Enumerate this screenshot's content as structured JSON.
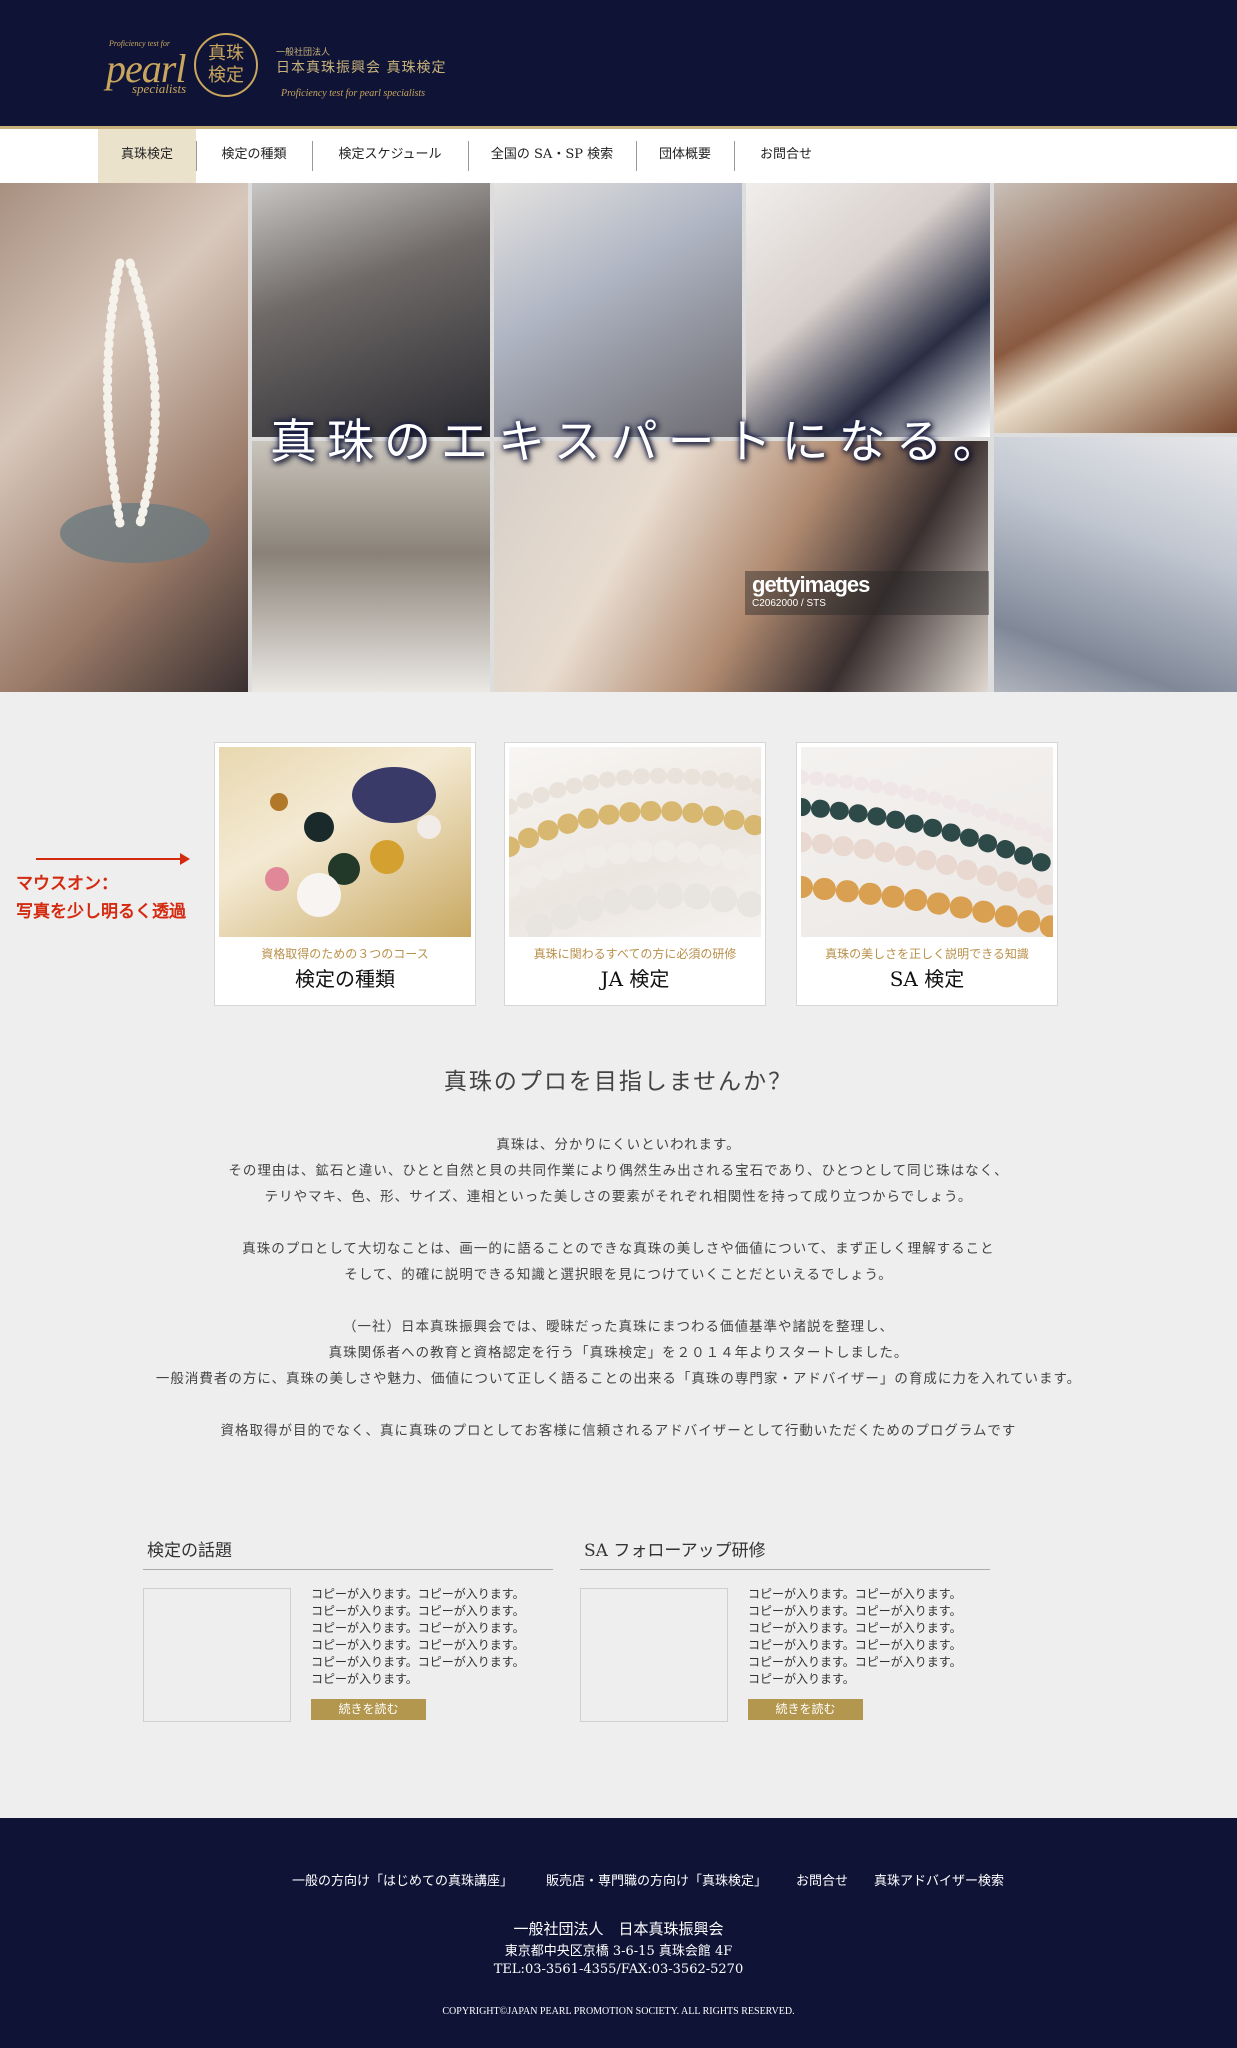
{
  "header": {
    "logo": {
      "small_text": "Proficiency test for",
      "wordmark": "pearl",
      "wordmark_sub": "specialists",
      "seal_line1": "真珠",
      "seal_line2": "検定",
      "org_small": "一般社団法人",
      "org_name": "日本真珠振興会 真珠検定",
      "subtitle": "Proficiency test for pearl specialists"
    },
    "bg_color": "#0f1437",
    "accent_color": "#c9b27a"
  },
  "nav": {
    "items": [
      {
        "label": "真珠検定",
        "active": true
      },
      {
        "label": "検定の種類",
        "active": false
      },
      {
        "label": "検定スケジュール",
        "active": false
      },
      {
        "label": "全国の SA・SP 検索",
        "active": false
      },
      {
        "label": "団体概要",
        "active": false
      },
      {
        "label": "お問合せ",
        "active": false
      }
    ]
  },
  "hero": {
    "title": "真珠のエキスパートになる。",
    "watermark": "gettyimages",
    "watermark_credit": "C2062000 / STS"
  },
  "cards": [
    {
      "subtitle": "資格取得のための３つのコース",
      "title": "検定の種類",
      "image": "colorful-pearls-photo"
    },
    {
      "subtitle": "真珠に関わるすべての方に必須の研修",
      "title": "JA 検定",
      "image": "white-gold-pearl-strands-photo"
    },
    {
      "subtitle": "真珠の美しさを正しく説明できる知識",
      "title": "SA 検定",
      "image": "multicolor-pearl-strands-photo"
    }
  ],
  "annotation": {
    "line1": "マウスオン：",
    "line2": "写真を少し明るく透過",
    "color": "#d42a10"
  },
  "intro": {
    "heading": "真珠のプロを目指しませんか？",
    "paragraphs": [
      [
        "真珠は、分かりにくいといわれます。",
        "その理由は、鉱石と違い、ひとと自然と貝の共同作業により偶然生み出される宝石であり、ひとつとして同じ珠はなく、",
        "テリやマキ、色、形、サイズ、連相といった美しさの要素がそれぞれ相関性を持って成り立つからでしょう。"
      ],
      [
        "真珠のプロとして大切なことは、画一的に語ることのできな真珠の美しさや価値について、まず正しく理解すること",
        "そして、的確に説明できる知識と選択眼を見につけていくことだといえるでしょう。"
      ],
      [
        "（一社）日本真珠振興会では、曖昧だった真珠にまつわる価値基準や諸説を整理し、",
        "真珠関係者への教育と資格認定を行う「真珠検定」を２０１４年よりスタートしました。",
        "一般消費者の方に、真珠の美しさや魅力、価値について正しく語ることの出来る「真珠の専門家・アドバイザー」の育成に力を入れています。"
      ],
      [
        "資格取得が目的でなく、真に真珠のプロとしてお客様に信頼されるアドバイザーとして行動いただくためのプログラムです"
      ]
    ]
  },
  "news": [
    {
      "title": "検定の話題",
      "lines": [
        "コピーが入ります。コピーが入ります。",
        "コピーが入ります。コピーが入ります。",
        "コピーが入ります。コピーが入ります。",
        "コピーが入ります。コピーが入ります。",
        "コピーが入ります。コピーが入ります。",
        "コピーが入ります。"
      ],
      "button": "続きを読む"
    },
    {
      "title": "SA フォローアップ研修",
      "lines": [
        "コピーが入ります。コピーが入ります。",
        "コピーが入ります。コピーが入ります。",
        "コピーが入ります。コピーが入ります。",
        "コピーが入ります。コピーが入ります。",
        "コピーが入ります。コピーが入ります。",
        "コピーが入ります。"
      ],
      "button": "続きを読む"
    }
  ],
  "footer": {
    "links": [
      "一般の方向け「はじめての真珠講座」",
      "販売店・専門職の方向け「真珠検定」",
      "お問合せ",
      "真珠アドバイザー検索"
    ],
    "org": "一般社団法人　日本真珠振興会",
    "address": "東京都中央区京橋 3-6-15 真珠会館 4F",
    "tel": "TEL:03-3561-4355/FAX:03-3562-5270",
    "copyright": "COPYRIGHT©JAPAN PEARL PROMOTION SOCIETY. ALL RIGHTS RESERVED."
  }
}
